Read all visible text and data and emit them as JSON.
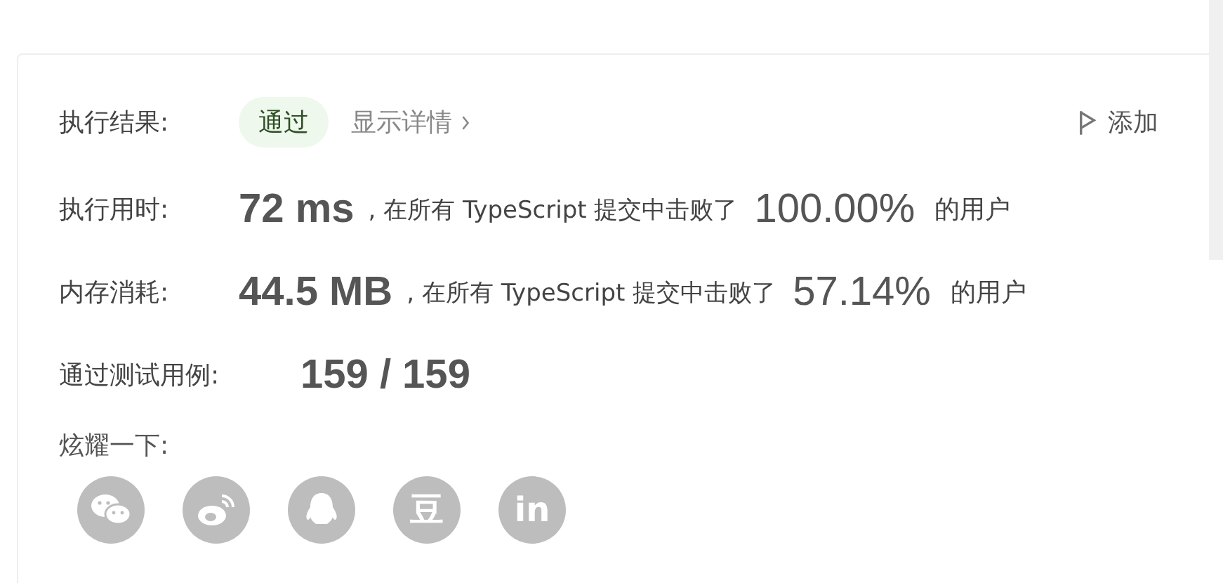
{
  "result": {
    "label": "执行结果:",
    "badge": "通过",
    "details_link": "显示详情",
    "add_note": "添加"
  },
  "runtime": {
    "label": "执行用时:",
    "value": "72 ms",
    "middle": ", 在所有 TypeScript 提交中击败了",
    "percent": "100.00%",
    "suffix": "的用户"
  },
  "memory": {
    "label": "内存消耗:",
    "value": "44.5 MB",
    "middle": ", 在所有 TypeScript 提交中击败了",
    "percent": "57.14%",
    "suffix": "的用户"
  },
  "tests": {
    "label": "通过测试用例:",
    "value": "159 / 159"
  },
  "share": {
    "label": "炫耀一下:",
    "buttons": [
      {
        "kind": "chat"
      },
      {
        "kind": "eye"
      },
      {
        "kind": "penguin"
      },
      {
        "kind": "glyph",
        "text": "豆"
      },
      {
        "kind": "glyph",
        "text": "in"
      }
    ]
  }
}
